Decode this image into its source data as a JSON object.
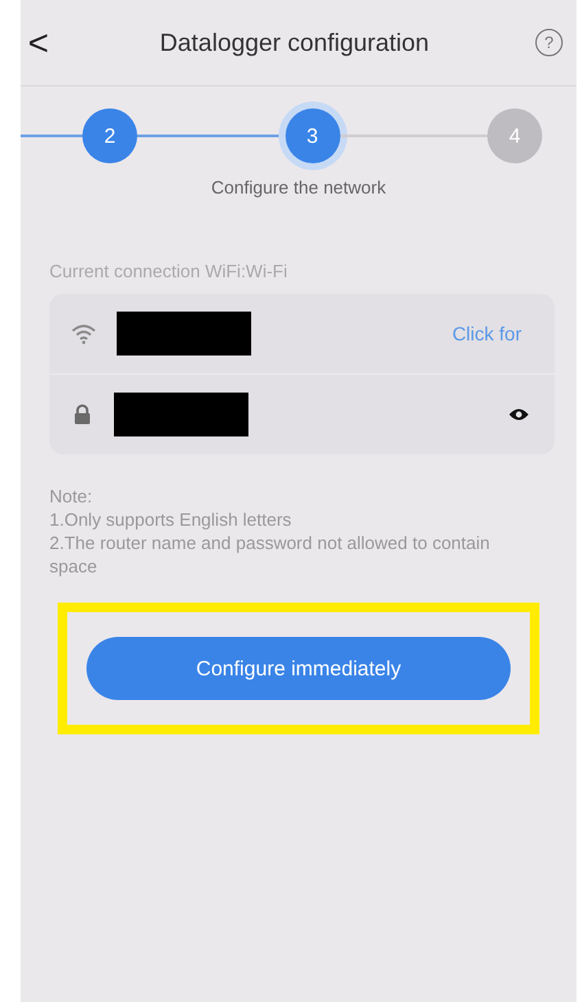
{
  "header": {
    "back": "<",
    "title": "Datalogger configuration",
    "help": "?"
  },
  "steps": [
    {
      "number": "2",
      "completed": true,
      "selected": false
    },
    {
      "number": "3",
      "completed": true,
      "selected": true
    },
    {
      "number": "4",
      "completed": false,
      "selected": false
    }
  ],
  "step_caption": "Configure the network",
  "connection_label": "Current connection WiFi:Wi-Fi",
  "fields": [
    {
      "kind": "wifi",
      "redacted": true,
      "action": "Click for"
    },
    {
      "kind": "password",
      "redacted": true
    }
  ],
  "note": [
    "Note:",
    "1.Only supports English letters",
    "2.The router name and password not allowed to contain space"
  ],
  "configure_button": {
    "label": "Configure immediately",
    "highlighted": true
  }
}
